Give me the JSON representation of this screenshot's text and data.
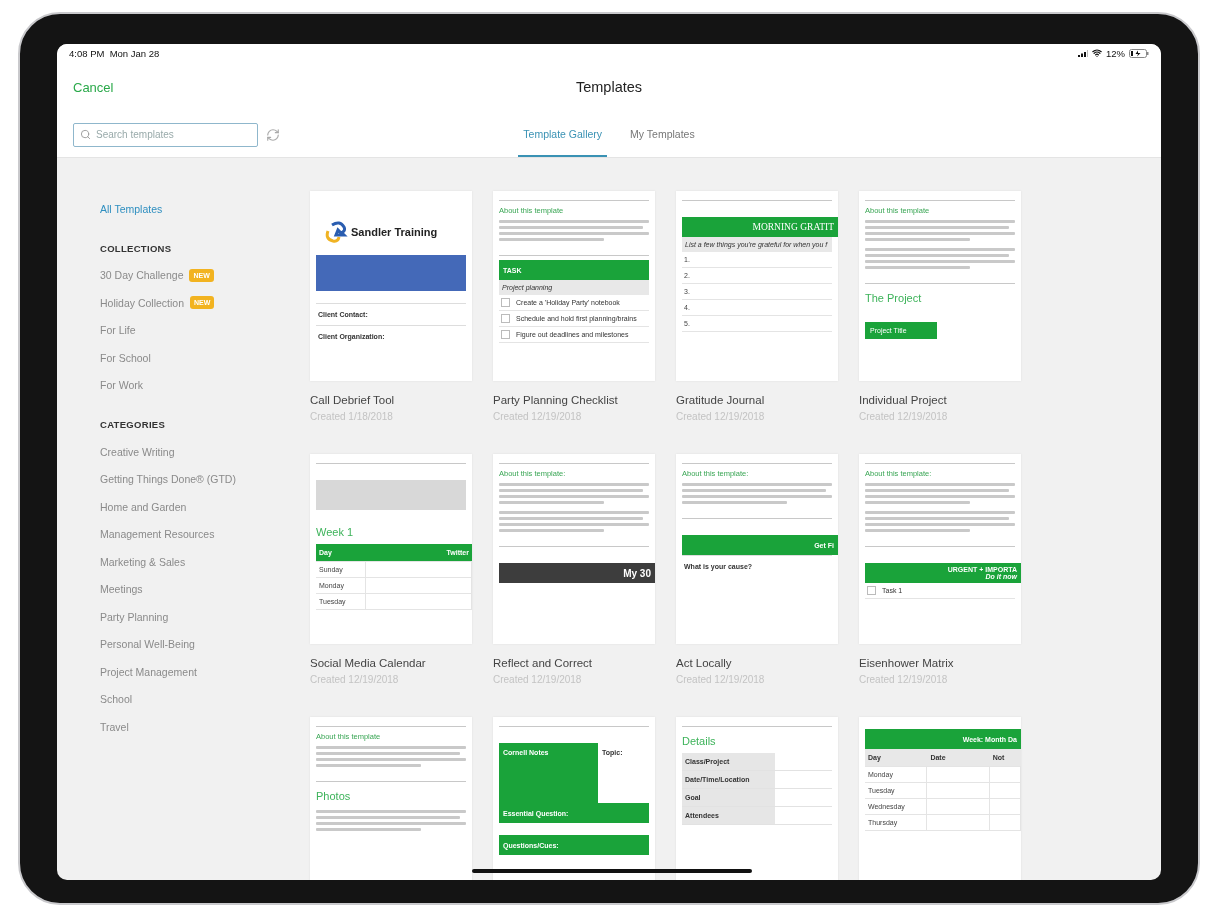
{
  "status_bar": {
    "time": "4:08 PM",
    "date": "Mon Jan 28",
    "battery": "12%"
  },
  "nav": {
    "cancel": "Cancel",
    "title": "Templates"
  },
  "search": {
    "placeholder": "Search templates"
  },
  "tabs": [
    {
      "label": "Template Gallery",
      "selected": true
    },
    {
      "label": "My Templates",
      "selected": false
    }
  ],
  "sidebar": {
    "top_items": [
      {
        "label": "All Templates",
        "selected": true
      }
    ],
    "sections": [
      {
        "heading": "COLLECTIONS",
        "items": [
          {
            "label": "30 Day Challenge",
            "badge": "NEW",
            "selected": false
          },
          {
            "label": "Holiday Collection",
            "badge": "NEW",
            "selected": false
          },
          {
            "label": "For Life",
            "selected": false
          },
          {
            "label": "For School",
            "selected": false
          },
          {
            "label": "For Work",
            "selected": false
          }
        ]
      },
      {
        "heading": "CATEGORIES",
        "items": [
          {
            "label": "Creative Writing",
            "selected": false
          },
          {
            "label": "Getting Things Done® (GTD)",
            "selected": false
          },
          {
            "label": "Home and Garden",
            "selected": false
          },
          {
            "label": "Management Resources",
            "selected": false
          },
          {
            "label": "Marketing & Sales",
            "selected": false
          },
          {
            "label": "Meetings",
            "selected": false
          },
          {
            "label": "Party Planning",
            "selected": false
          },
          {
            "label": "Personal Well-Being",
            "selected": false
          },
          {
            "label": "Project Management",
            "selected": false
          },
          {
            "label": "School",
            "selected": false
          },
          {
            "label": "Travel",
            "selected": false
          }
        ]
      }
    ]
  },
  "templates": [
    {
      "title": "Call Debrief Tool",
      "created": "Created 1/18/2018",
      "preview": [
        {
          "kind": "space"
        },
        {
          "kind": "logo",
          "text": "Sandler Training"
        },
        {
          "kind": "blue_block"
        },
        {
          "kind": "space"
        },
        {
          "kind": "field",
          "text": "Client Contact:"
        },
        {
          "kind": "field",
          "text": "Client Organization:"
        }
      ]
    },
    {
      "title": "Party Planning Checklist",
      "created": "Created 12/19/2018",
      "preview": [
        {
          "kind": "rule"
        },
        {
          "kind": "heading",
          "text": "About this template"
        },
        {
          "kind": "para_lines"
        },
        {
          "kind": "rule"
        },
        {
          "kind": "header",
          "text": "TASK"
        },
        {
          "kind": "shaded",
          "text": "Project planning"
        },
        {
          "kind": "check",
          "text": "Create a 'Holiday Party' notebook",
          "checked": false
        },
        {
          "kind": "check",
          "text": "Schedule and hold first planning/brains",
          "checked": false
        },
        {
          "kind": "check",
          "text": "Figure out deadlines and milestones",
          "checked": false
        }
      ]
    },
    {
      "title": "Gratitude Journal",
      "created": "Created 12/19/2018",
      "preview": [
        {
          "kind": "rule"
        },
        {
          "kind": "space"
        },
        {
          "kind": "serif_header",
          "text": "MORNING GRATIT"
        },
        {
          "kind": "shaded",
          "text": "List a few things you're grateful for when you f"
        },
        {
          "kind": "row",
          "text": "1."
        },
        {
          "kind": "row",
          "text": "2."
        },
        {
          "kind": "row",
          "text": "3."
        },
        {
          "kind": "row",
          "text": "4."
        },
        {
          "kind": "row",
          "text": "5."
        }
      ]
    },
    {
      "title": "Individual Project",
      "created": "Created 12/19/2018",
      "preview": [
        {
          "kind": "rule"
        },
        {
          "kind": "heading",
          "text": "About this template"
        },
        {
          "kind": "para_lines"
        },
        {
          "kind": "para_lines"
        },
        {
          "kind": "rule"
        },
        {
          "kind": "title",
          "text": "The Project"
        },
        {
          "kind": "space"
        },
        {
          "kind": "tag",
          "text": "Project Title"
        }
      ]
    },
    {
      "title": "Social Media Calendar",
      "created": "Created 12/19/2018",
      "preview": [
        {
          "kind": "rule"
        },
        {
          "kind": "space"
        },
        {
          "kind": "gray_block"
        },
        {
          "kind": "space"
        },
        {
          "kind": "title",
          "text": "Week 1"
        },
        {
          "kind": "green_table",
          "header": [
            "Day",
            "Twitter"
          ],
          "rows": [
            "Sunday",
            "Monday",
            "Tuesday"
          ]
        }
      ]
    },
    {
      "title": "Reflect and Correct",
      "created": "Created 12/19/2018",
      "preview": [
        {
          "kind": "rule"
        },
        {
          "kind": "heading",
          "text": "About this template:"
        },
        {
          "kind": "para_lines"
        },
        {
          "kind": "para_lines"
        },
        {
          "kind": "rule"
        },
        {
          "kind": "space"
        },
        {
          "kind": "dark_bar",
          "text": "My 30"
        }
      ]
    },
    {
      "title": "Act Locally",
      "created": "Created 12/19/2018",
      "preview": [
        {
          "kind": "rule"
        },
        {
          "kind": "heading",
          "text": "About this template:"
        },
        {
          "kind": "para_lines"
        },
        {
          "kind": "rule"
        },
        {
          "kind": "space"
        },
        {
          "kind": "header_right",
          "text": "Get Fi"
        },
        {
          "kind": "field",
          "text": "What is your cause?"
        }
      ]
    },
    {
      "title": "Eisenhower Matrix",
      "created": "Created 12/19/2018",
      "preview": [
        {
          "kind": "rule"
        },
        {
          "kind": "heading",
          "text": "About this template:"
        },
        {
          "kind": "para_lines"
        },
        {
          "kind": "para_lines"
        },
        {
          "kind": "rule"
        },
        {
          "kind": "space"
        },
        {
          "kind": "header_right",
          "text": "URGENT + IMPORTA",
          "sub": "Do it now"
        },
        {
          "kind": "check",
          "text": "Task 1",
          "checked": false
        }
      ]
    },
    {
      "preview": [
        {
          "kind": "rule"
        },
        {
          "kind": "heading",
          "text": "About this template"
        },
        {
          "kind": "para_lines"
        },
        {
          "kind": "rule"
        },
        {
          "kind": "title",
          "text": "Photos"
        },
        {
          "kind": "para_lines"
        }
      ]
    },
    {
      "preview": [
        {
          "kind": "rule"
        },
        {
          "kind": "space"
        },
        {
          "kind": "split",
          "left": "Cornell Notes",
          "right": "Topic:"
        },
        {
          "kind": "header",
          "text": "Essential Question:"
        },
        {
          "kind": "space"
        },
        {
          "kind": "header",
          "text": "Questions/Cues:"
        }
      ]
    },
    {
      "preview": [
        {
          "kind": "rule"
        },
        {
          "kind": "title",
          "text": "Details"
        },
        {
          "kind": "label",
          "text": "Class/Project"
        },
        {
          "kind": "label",
          "text": "Date/Time/Location"
        },
        {
          "kind": "label",
          "text": "Goal"
        },
        {
          "kind": "label",
          "text": "Attendees"
        }
      ]
    },
    {
      "preview": [
        {
          "kind": "space"
        },
        {
          "kind": "header_right",
          "text": "Week: Month Da"
        },
        {
          "kind": "gray_table",
          "header": [
            "Day",
            "Date",
            "Not"
          ],
          "rows": [
            "Monday",
            "Tuesday",
            "Wednesday",
            "Thursday"
          ]
        }
      ]
    }
  ]
}
